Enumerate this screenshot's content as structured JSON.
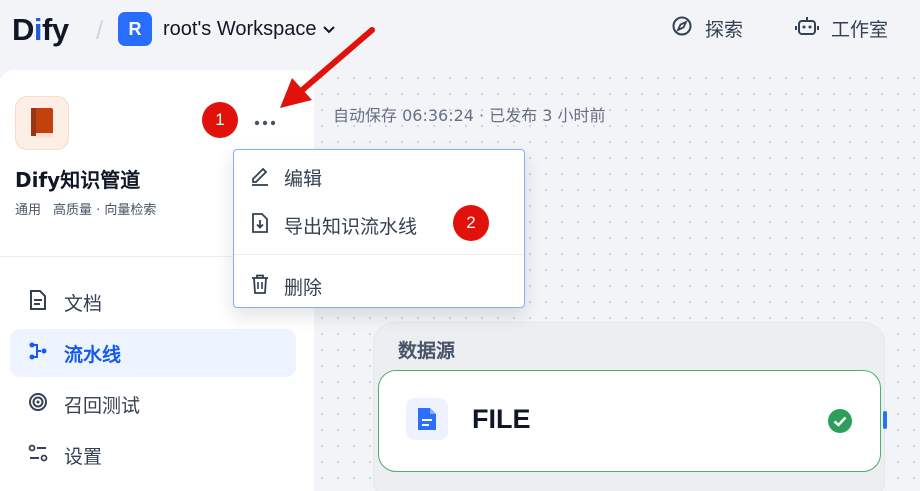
{
  "header": {
    "logo_text_pre": "D",
    "logo_text_accent": "i",
    "logo_text_post": "fy",
    "workspace_initial": "R",
    "workspace_name": "root's Workspace",
    "nav": [
      {
        "label": "探索",
        "icon": "compass-icon"
      },
      {
        "label": "工作室",
        "icon": "robot-icon"
      }
    ]
  },
  "sidebar": {
    "app_name": "Dify知识管道",
    "tags": [
      "通用",
      "高质量 · 向量检索"
    ],
    "items": [
      {
        "label": "文档",
        "icon": "document-icon",
        "active": false
      },
      {
        "label": "流水线",
        "icon": "pipeline-icon",
        "active": true
      },
      {
        "label": "召回测试",
        "icon": "target-icon",
        "active": false
      },
      {
        "label": "设置",
        "icon": "settings-icon",
        "active": false
      }
    ]
  },
  "canvas": {
    "status": "自动保存 06:36:24 · 已发布 3 小时前",
    "node": {
      "group_title": "数据源",
      "label": "FILE"
    }
  },
  "dropdown": {
    "items": [
      {
        "label": "编辑",
        "icon": "pencil-icon"
      },
      {
        "label": "导出知识流水线",
        "icon": "export-icon"
      },
      {
        "label": "删除",
        "icon": "trash-icon"
      }
    ]
  },
  "annotations": {
    "step1": "1",
    "step2": "2"
  },
  "colors": {
    "accent": "#155aef",
    "annotation_red": "#e0120b",
    "success_green": "#2e9e5b"
  }
}
